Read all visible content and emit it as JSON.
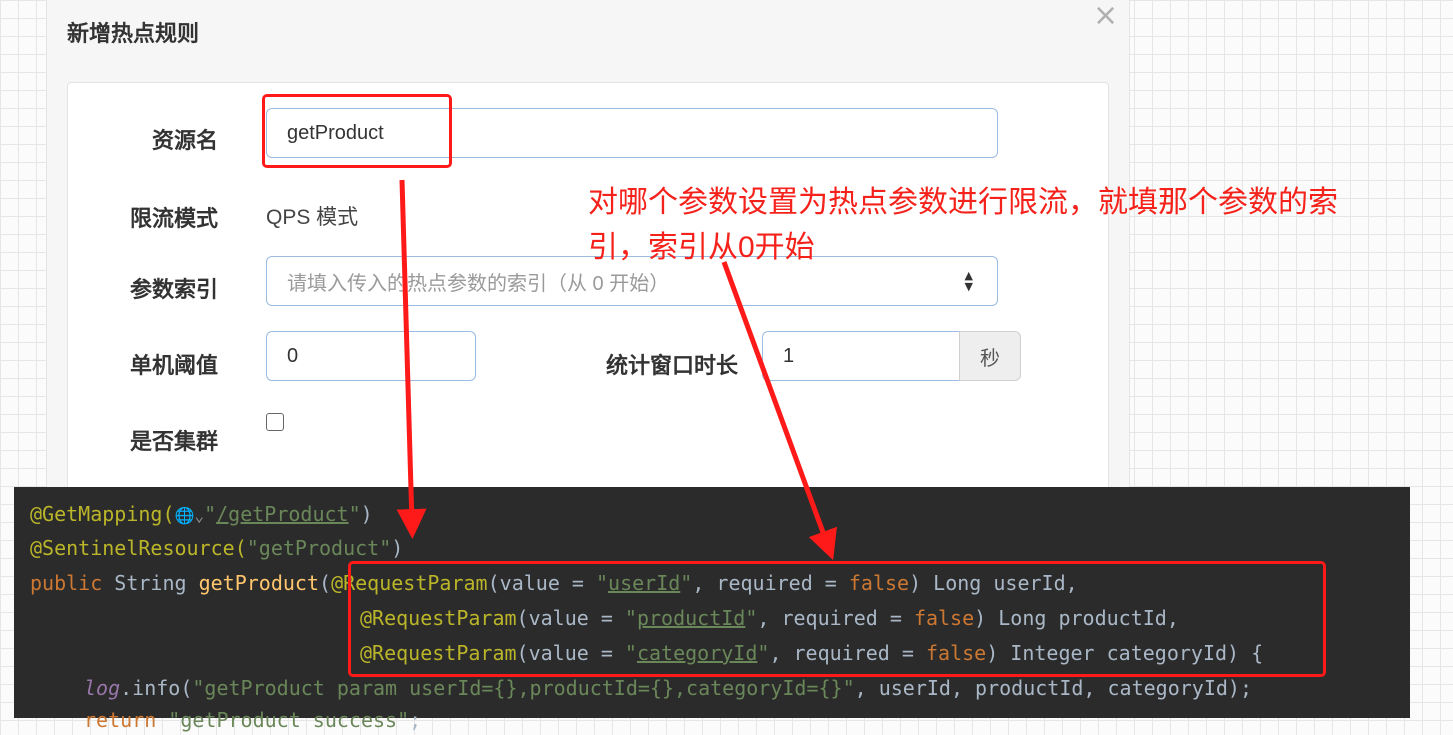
{
  "dialog": {
    "title": "新增热点规则",
    "close_glyph": "×",
    "fields": {
      "resource": {
        "label": "资源名",
        "value": "getProduct"
      },
      "mode": {
        "label": "限流模式",
        "value": "QPS 模式"
      },
      "param_index": {
        "label": "参数索引",
        "placeholder": "请填入传入的热点参数的索引（从 0 开始）"
      },
      "threshold": {
        "label": "单机阈值",
        "value": "0"
      },
      "window": {
        "label": "统计窗口时长",
        "value": "1",
        "unit": "秒"
      },
      "cluster": {
        "label": "是否集群",
        "checked": false
      }
    }
  },
  "annotation": {
    "line1": "对哪个参数设置为热点参数进行限流，就填那个参数的索",
    "line2": "引，索引从0开始",
    "color": "#f5221b"
  },
  "code": {
    "l1": {
      "ann": "@GetMapping(",
      "globe": "🌐⌄",
      "q1": "\"",
      "path": "/getProduct",
      "q2": "\"",
      "close": ")"
    },
    "l2": {
      "ann": "@SentinelResource(",
      "str": "\"getProduct\"",
      "close": ")"
    },
    "l3": {
      "kw": "public ",
      "type": "String ",
      "fn": "getProduct",
      "paren": "(",
      "ann": "@RequestParam",
      "p1": "(value = ",
      "q1": "\"",
      "name": "userId",
      "q2": "\"",
      "p2": ", required = ",
      "false": "false",
      "p3": ") Long userId,"
    },
    "l4": {
      "ann": "@RequestParam",
      "p1": "(value = ",
      "q1": "\"",
      "name": "productId",
      "q2": "\"",
      "p2": ", required = ",
      "false": "false",
      "p3": ") Long productId,"
    },
    "l5": {
      "ann": "@RequestParam",
      "p1": "(value = ",
      "q1": "\"",
      "name": "categoryId",
      "q2": "\"",
      "p2": ", required = ",
      "false": "false",
      "p3": ") Integer categoryId) {"
    },
    "l6": {
      "log": "log",
      "p1": ".info(",
      "str": "\"getProduct param userId={},productId={},categoryId={}\"",
      "p2": ", userId, productId, categoryId);"
    },
    "l7": {
      "kw": "return ",
      "str": "\"getProduct success\"",
      "p1": ";"
    }
  }
}
